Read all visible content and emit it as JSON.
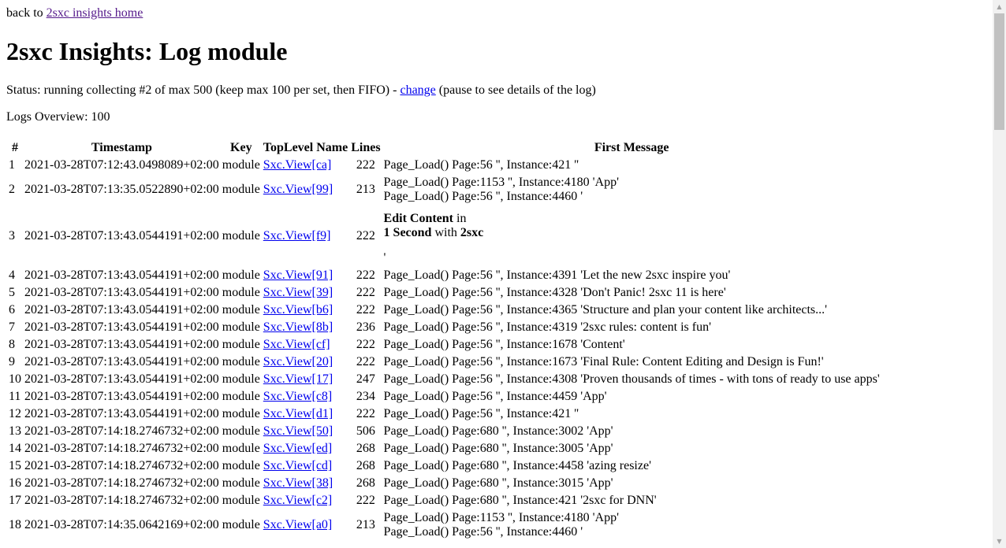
{
  "nav": {
    "back_prefix": "back to ",
    "back_link": "2sxc insights home"
  },
  "page_title": "2sxc Insights: Log module",
  "status": {
    "prefix": "Status: running collecting #2 of max 500 (keep max 100 per set, then FIFO) - ",
    "change_link": "change",
    "suffix": " (pause to see details of the log)"
  },
  "overview": "Logs Overview: 100",
  "table": {
    "headers": [
      "#",
      "Timestamp",
      "Key",
      "TopLevel Name",
      "Lines",
      "First Message"
    ],
    "rows": [
      {
        "num": "1",
        "timestamp": "2021-03-28T07:12:43.0498089+02:00",
        "key": "module",
        "name": "Sxc.View[ca]",
        "lines": "222",
        "message": [
          "Page_Load() Page:56 '', Instance:421 ''"
        ]
      },
      {
        "num": "2",
        "timestamp": "2021-03-28T07:13:35.0522890+02:00",
        "key": "module",
        "name": "Sxc.View[99]",
        "lines": "213",
        "message": [
          "Page_Load() Page:1153 '', Instance:4180 'App'",
          "Page_Load() Page:56 '', Instance:4460 '"
        ]
      },
      {
        "num": "3",
        "timestamp": "2021-03-28T07:13:43.0544191+02:00",
        "key": "module",
        "name": "Sxc.View[f9]",
        "lines": "222",
        "rich": {
          "bold1": "Edit Content",
          "mid": " in",
          "bold2": "1 Second",
          "with": " with ",
          "bold3": "2sxc",
          "tail": "'"
        }
      },
      {
        "num": "4",
        "timestamp": "2021-03-28T07:13:43.0544191+02:00",
        "key": "module",
        "name": "Sxc.View[91]",
        "lines": "222",
        "message": [
          "Page_Load() Page:56 '', Instance:4391 'Let the new 2sxc inspire you'"
        ]
      },
      {
        "num": "5",
        "timestamp": "2021-03-28T07:13:43.0544191+02:00",
        "key": "module",
        "name": "Sxc.View[39]",
        "lines": "222",
        "message": [
          "Page_Load() Page:56 '', Instance:4328 'Don't Panic! 2sxc 11 is here'"
        ]
      },
      {
        "num": "6",
        "timestamp": "2021-03-28T07:13:43.0544191+02:00",
        "key": "module",
        "name": "Sxc.View[b6]",
        "lines": "222",
        "message": [
          "Page_Load() Page:56 '', Instance:4365 'Structure and plan your content like architects...'"
        ]
      },
      {
        "num": "7",
        "timestamp": "2021-03-28T07:13:43.0544191+02:00",
        "key": "module",
        "name": "Sxc.View[8b]",
        "lines": "236",
        "message": [
          "Page_Load() Page:56 '', Instance:4319 '2sxc rules: content is fun'"
        ]
      },
      {
        "num": "8",
        "timestamp": "2021-03-28T07:13:43.0544191+02:00",
        "key": "module",
        "name": "Sxc.View[cf]",
        "lines": "222",
        "message": [
          "Page_Load() Page:56 '', Instance:1678 'Content'"
        ]
      },
      {
        "num": "9",
        "timestamp": "2021-03-28T07:13:43.0544191+02:00",
        "key": "module",
        "name": "Sxc.View[20]",
        "lines": "222",
        "message": [
          "Page_Load() Page:56 '', Instance:1673 'Final Rule: Content Editing and Design is Fun!'"
        ]
      },
      {
        "num": "10",
        "timestamp": "2021-03-28T07:13:43.0544191+02:00",
        "key": "module",
        "name": "Sxc.View[17]",
        "lines": "247",
        "message": [
          "Page_Load() Page:56 '', Instance:4308 'Proven thousands of times - with tons of ready to use apps'"
        ]
      },
      {
        "num": "11",
        "timestamp": "2021-03-28T07:13:43.0544191+02:00",
        "key": "module",
        "name": "Sxc.View[c8]",
        "lines": "234",
        "message": [
          "Page_Load() Page:56 '', Instance:4459 'App'"
        ]
      },
      {
        "num": "12",
        "timestamp": "2021-03-28T07:13:43.0544191+02:00",
        "key": "module",
        "name": "Sxc.View[d1]",
        "lines": "222",
        "message": [
          "Page_Load() Page:56 '', Instance:421 ''"
        ]
      },
      {
        "num": "13",
        "timestamp": "2021-03-28T07:14:18.2746732+02:00",
        "key": "module",
        "name": "Sxc.View[50]",
        "lines": "506",
        "message": [
          "Page_Load() Page:680 '', Instance:3002 'App'"
        ]
      },
      {
        "num": "14",
        "timestamp": "2021-03-28T07:14:18.2746732+02:00",
        "key": "module",
        "name": "Sxc.View[ed]",
        "lines": "268",
        "message": [
          "Page_Load() Page:680 '', Instance:3005 'App'"
        ]
      },
      {
        "num": "15",
        "timestamp": "2021-03-28T07:14:18.2746732+02:00",
        "key": "module",
        "name": "Sxc.View[cd]",
        "lines": "268",
        "message": [
          "Page_Load() Page:680 '', Instance:4458 'azing resize'"
        ]
      },
      {
        "num": "16",
        "timestamp": "2021-03-28T07:14:18.2746732+02:00",
        "key": "module",
        "name": "Sxc.View[38]",
        "lines": "268",
        "message": [
          "Page_Load() Page:680 '', Instance:3015 'App'"
        ]
      },
      {
        "num": "17",
        "timestamp": "2021-03-28T07:14:18.2746732+02:00",
        "key": "module",
        "name": "Sxc.View[c2]",
        "lines": "222",
        "message": [
          "Page_Load() Page:680 '', Instance:421 '2sxc for DNN'"
        ]
      },
      {
        "num": "18",
        "timestamp": "2021-03-28T07:14:35.0642169+02:00",
        "key": "module",
        "name": "Sxc.View[a0]",
        "lines": "213",
        "message": [
          "Page_Load() Page:1153 '', Instance:4180 'App'",
          "Page_Load() Page:56 '', Instance:4460 '"
        ]
      }
    ]
  },
  "scrollbar": {
    "up_icon": "triangle-up-icon",
    "down_icon": "triangle-down-icon"
  }
}
